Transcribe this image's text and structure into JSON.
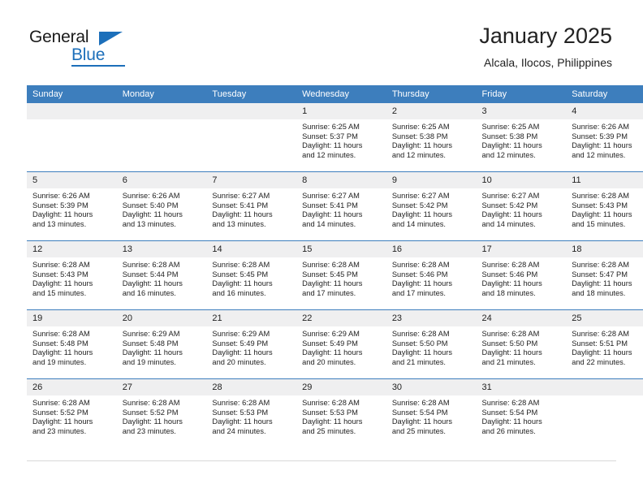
{
  "brand": {
    "name_part1": "General",
    "name_part2": "Blue",
    "accent_color": "#1c6fba"
  },
  "header": {
    "title": "January 2025",
    "location": "Alcala, Ilocos, Philippines"
  },
  "theme": {
    "header_blue": "#3d7ebd",
    "daynum_bg": "#efeff0",
    "text": "#222222"
  },
  "calendar": {
    "weekday_headers": [
      "Sunday",
      "Monday",
      "Tuesday",
      "Wednesday",
      "Thursday",
      "Friday",
      "Saturday"
    ],
    "weeks": [
      [
        {
          "day": "",
          "empty": true,
          "sunrise": "",
          "sunset": "",
          "daylight_line1": "",
          "daylight_line2": ""
        },
        {
          "day": "",
          "empty": true,
          "sunrise": "",
          "sunset": "",
          "daylight_line1": "",
          "daylight_line2": ""
        },
        {
          "day": "",
          "empty": true,
          "sunrise": "",
          "sunset": "",
          "daylight_line1": "",
          "daylight_line2": ""
        },
        {
          "day": "1",
          "empty": false,
          "sunrise": "Sunrise: 6:25 AM",
          "sunset": "Sunset: 5:37 PM",
          "daylight_line1": "Daylight: 11 hours",
          "daylight_line2": "and 12 minutes."
        },
        {
          "day": "2",
          "empty": false,
          "sunrise": "Sunrise: 6:25 AM",
          "sunset": "Sunset: 5:38 PM",
          "daylight_line1": "Daylight: 11 hours",
          "daylight_line2": "and 12 minutes."
        },
        {
          "day": "3",
          "empty": false,
          "sunrise": "Sunrise: 6:25 AM",
          "sunset": "Sunset: 5:38 PM",
          "daylight_line1": "Daylight: 11 hours",
          "daylight_line2": "and 12 minutes."
        },
        {
          "day": "4",
          "empty": false,
          "sunrise": "Sunrise: 6:26 AM",
          "sunset": "Sunset: 5:39 PM",
          "daylight_line1": "Daylight: 11 hours",
          "daylight_line2": "and 12 minutes."
        }
      ],
      [
        {
          "day": "5",
          "empty": false,
          "sunrise": "Sunrise: 6:26 AM",
          "sunset": "Sunset: 5:39 PM",
          "daylight_line1": "Daylight: 11 hours",
          "daylight_line2": "and 13 minutes."
        },
        {
          "day": "6",
          "empty": false,
          "sunrise": "Sunrise: 6:26 AM",
          "sunset": "Sunset: 5:40 PM",
          "daylight_line1": "Daylight: 11 hours",
          "daylight_line2": "and 13 minutes."
        },
        {
          "day": "7",
          "empty": false,
          "sunrise": "Sunrise: 6:27 AM",
          "sunset": "Sunset: 5:41 PM",
          "daylight_line1": "Daylight: 11 hours",
          "daylight_line2": "and 13 minutes."
        },
        {
          "day": "8",
          "empty": false,
          "sunrise": "Sunrise: 6:27 AM",
          "sunset": "Sunset: 5:41 PM",
          "daylight_line1": "Daylight: 11 hours",
          "daylight_line2": "and 14 minutes."
        },
        {
          "day": "9",
          "empty": false,
          "sunrise": "Sunrise: 6:27 AM",
          "sunset": "Sunset: 5:42 PM",
          "daylight_line1": "Daylight: 11 hours",
          "daylight_line2": "and 14 minutes."
        },
        {
          "day": "10",
          "empty": false,
          "sunrise": "Sunrise: 6:27 AM",
          "sunset": "Sunset: 5:42 PM",
          "daylight_line1": "Daylight: 11 hours",
          "daylight_line2": "and 14 minutes."
        },
        {
          "day": "11",
          "empty": false,
          "sunrise": "Sunrise: 6:28 AM",
          "sunset": "Sunset: 5:43 PM",
          "daylight_line1": "Daylight: 11 hours",
          "daylight_line2": "and 15 minutes."
        }
      ],
      [
        {
          "day": "12",
          "empty": false,
          "sunrise": "Sunrise: 6:28 AM",
          "sunset": "Sunset: 5:43 PM",
          "daylight_line1": "Daylight: 11 hours",
          "daylight_line2": "and 15 minutes."
        },
        {
          "day": "13",
          "empty": false,
          "sunrise": "Sunrise: 6:28 AM",
          "sunset": "Sunset: 5:44 PM",
          "daylight_line1": "Daylight: 11 hours",
          "daylight_line2": "and 16 minutes."
        },
        {
          "day": "14",
          "empty": false,
          "sunrise": "Sunrise: 6:28 AM",
          "sunset": "Sunset: 5:45 PM",
          "daylight_line1": "Daylight: 11 hours",
          "daylight_line2": "and 16 minutes."
        },
        {
          "day": "15",
          "empty": false,
          "sunrise": "Sunrise: 6:28 AM",
          "sunset": "Sunset: 5:45 PM",
          "daylight_line1": "Daylight: 11 hours",
          "daylight_line2": "and 17 minutes."
        },
        {
          "day": "16",
          "empty": false,
          "sunrise": "Sunrise: 6:28 AM",
          "sunset": "Sunset: 5:46 PM",
          "daylight_line1": "Daylight: 11 hours",
          "daylight_line2": "and 17 minutes."
        },
        {
          "day": "17",
          "empty": false,
          "sunrise": "Sunrise: 6:28 AM",
          "sunset": "Sunset: 5:46 PM",
          "daylight_line1": "Daylight: 11 hours",
          "daylight_line2": "and 18 minutes."
        },
        {
          "day": "18",
          "empty": false,
          "sunrise": "Sunrise: 6:28 AM",
          "sunset": "Sunset: 5:47 PM",
          "daylight_line1": "Daylight: 11 hours",
          "daylight_line2": "and 18 minutes."
        }
      ],
      [
        {
          "day": "19",
          "empty": false,
          "sunrise": "Sunrise: 6:28 AM",
          "sunset": "Sunset: 5:48 PM",
          "daylight_line1": "Daylight: 11 hours",
          "daylight_line2": "and 19 minutes."
        },
        {
          "day": "20",
          "empty": false,
          "sunrise": "Sunrise: 6:29 AM",
          "sunset": "Sunset: 5:48 PM",
          "daylight_line1": "Daylight: 11 hours",
          "daylight_line2": "and 19 minutes."
        },
        {
          "day": "21",
          "empty": false,
          "sunrise": "Sunrise: 6:29 AM",
          "sunset": "Sunset: 5:49 PM",
          "daylight_line1": "Daylight: 11 hours",
          "daylight_line2": "and 20 minutes."
        },
        {
          "day": "22",
          "empty": false,
          "sunrise": "Sunrise: 6:29 AM",
          "sunset": "Sunset: 5:49 PM",
          "daylight_line1": "Daylight: 11 hours",
          "daylight_line2": "and 20 minutes."
        },
        {
          "day": "23",
          "empty": false,
          "sunrise": "Sunrise: 6:28 AM",
          "sunset": "Sunset: 5:50 PM",
          "daylight_line1": "Daylight: 11 hours",
          "daylight_line2": "and 21 minutes."
        },
        {
          "day": "24",
          "empty": false,
          "sunrise": "Sunrise: 6:28 AM",
          "sunset": "Sunset: 5:50 PM",
          "daylight_line1": "Daylight: 11 hours",
          "daylight_line2": "and 21 minutes."
        },
        {
          "day": "25",
          "empty": false,
          "sunrise": "Sunrise: 6:28 AM",
          "sunset": "Sunset: 5:51 PM",
          "daylight_line1": "Daylight: 11 hours",
          "daylight_line2": "and 22 minutes."
        }
      ],
      [
        {
          "day": "26",
          "empty": false,
          "sunrise": "Sunrise: 6:28 AM",
          "sunset": "Sunset: 5:52 PM",
          "daylight_line1": "Daylight: 11 hours",
          "daylight_line2": "and 23 minutes."
        },
        {
          "day": "27",
          "empty": false,
          "sunrise": "Sunrise: 6:28 AM",
          "sunset": "Sunset: 5:52 PM",
          "daylight_line1": "Daylight: 11 hours",
          "daylight_line2": "and 23 minutes."
        },
        {
          "day": "28",
          "empty": false,
          "sunrise": "Sunrise: 6:28 AM",
          "sunset": "Sunset: 5:53 PM",
          "daylight_line1": "Daylight: 11 hours",
          "daylight_line2": "and 24 minutes."
        },
        {
          "day": "29",
          "empty": false,
          "sunrise": "Sunrise: 6:28 AM",
          "sunset": "Sunset: 5:53 PM",
          "daylight_line1": "Daylight: 11 hours",
          "daylight_line2": "and 25 minutes."
        },
        {
          "day": "30",
          "empty": false,
          "sunrise": "Sunrise: 6:28 AM",
          "sunset": "Sunset: 5:54 PM",
          "daylight_line1": "Daylight: 11 hours",
          "daylight_line2": "and 25 minutes."
        },
        {
          "day": "31",
          "empty": false,
          "sunrise": "Sunrise: 6:28 AM",
          "sunset": "Sunset: 5:54 PM",
          "daylight_line1": "Daylight: 11 hours",
          "daylight_line2": "and 26 minutes."
        },
        {
          "day": "",
          "empty": true,
          "sunrise": "",
          "sunset": "",
          "daylight_line1": "",
          "daylight_line2": ""
        }
      ]
    ]
  }
}
